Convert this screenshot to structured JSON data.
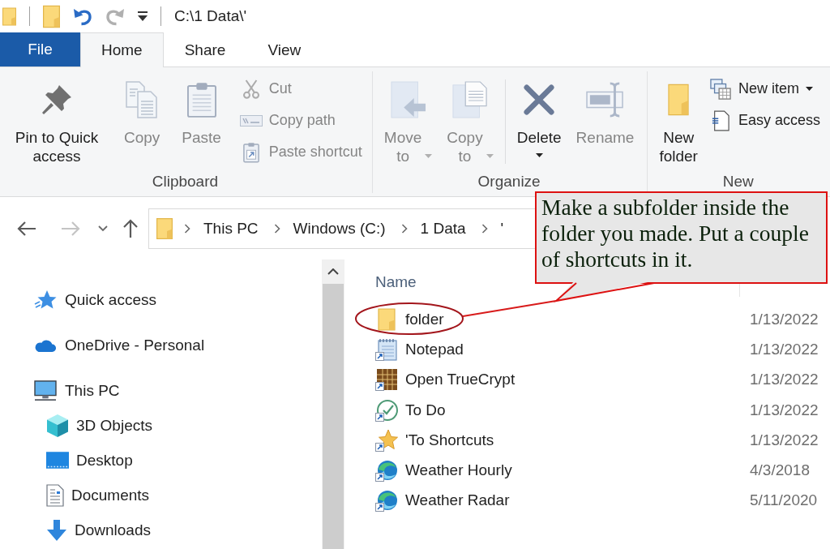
{
  "window": {
    "title": "C:\\1 Data\\'"
  },
  "quick_access_toolbar": {
    "buttons": [
      {
        "disabled": false
      },
      {
        "disabled": false
      },
      {
        "disabled": false
      },
      {
        "disabled": true
      },
      {
        "disabled": false
      }
    ]
  },
  "ribbon": {
    "tabs": [
      {
        "kind": "menu",
        "label": "File",
        "selected": false
      },
      {
        "kind": "tab",
        "label": "Home",
        "selected": true
      },
      {
        "kind": "tab",
        "label": "Share",
        "selected": false
      },
      {
        "kind": "tab",
        "label": "View",
        "selected": false
      }
    ],
    "groups": [
      {
        "label": "Clipboard",
        "buttons": [
          {
            "kind": "large",
            "label": "Pin to Quick access",
            "disabled": false,
            "dropdown": false
          },
          {
            "kind": "large",
            "label": "Copy",
            "disabled": true,
            "dropdown": false
          },
          {
            "kind": "large",
            "label": "Paste",
            "disabled": true,
            "dropdown": false
          },
          {
            "kind": "small",
            "label": "Cut",
            "disabled": true,
            "dropdown": false
          },
          {
            "kind": "small",
            "label": "Copy path",
            "disabled": true,
            "dropdown": false
          },
          {
            "kind": "small",
            "label": "Paste shortcut",
            "disabled": true,
            "dropdown": false
          }
        ]
      },
      {
        "label": "Organize",
        "buttons": [
          {
            "kind": "large",
            "label": "Move to",
            "disabled": true,
            "dropdown": true
          },
          {
            "kind": "large",
            "label": "Copy to",
            "disabled": true,
            "dropdown": true
          },
          {
            "kind": "separator"
          },
          {
            "kind": "split",
            "label": "Delete",
            "disabled": false,
            "dropdown": true
          },
          {
            "kind": "large",
            "label": "Rename",
            "disabled": true,
            "dropdown": false
          }
        ]
      },
      {
        "label": "New",
        "buttons": [
          {
            "kind": "large",
            "label": "New folder",
            "disabled": false,
            "dropdown": false
          },
          {
            "kind": "small",
            "label": "New item",
            "disabled": false,
            "dropdown": true
          },
          {
            "kind": "small",
            "label": "Easy access",
            "disabled": false,
            "dropdown": false
          }
        ]
      }
    ]
  },
  "address_bar": {
    "navigation_buttons": [
      {
        "disabled": false
      },
      {
        "disabled": true
      },
      {
        "disabled": false
      },
      {
        "disabled": false
      }
    ],
    "crumbs": [
      "This PC",
      "Windows (C:)",
      "1 Data",
      "'"
    ]
  },
  "navigation_pane": {
    "items": [
      {
        "label": "Quick access"
      },
      {
        "label": "OneDrive - Personal"
      },
      {
        "label": "This PC",
        "children": [
          {
            "label": "3D Objects"
          },
          {
            "label": "Desktop"
          },
          {
            "label": "Documents"
          },
          {
            "label": "Downloads"
          }
        ]
      }
    ]
  },
  "file_list": {
    "columns": [
      "Name"
    ],
    "rows": [
      {
        "kind": "folder",
        "name": "folder",
        "column_2": "1/13/2022"
      },
      {
        "kind": "shortcut",
        "name": "Notepad",
        "column_2": "1/13/2022"
      },
      {
        "kind": "shortcut",
        "name": "Open TrueCrypt",
        "column_2": "1/13/2022"
      },
      {
        "kind": "shortcut",
        "name": "To Do",
        "column_2": "1/13/2022"
      },
      {
        "kind": "shortcut",
        "name": "'To Shortcuts",
        "column_2": "1/13/2022"
      },
      {
        "kind": "shortcut",
        "name": "Weather Hourly",
        "column_2": "4/3/2018"
      },
      {
        "kind": "shortcut",
        "name": "Weather Radar",
        "column_2": "5/11/2020"
      }
    ]
  },
  "annotation": {
    "text": "Make a subfolder inside the folder you made. Put a couple of shortcuts in it."
  }
}
